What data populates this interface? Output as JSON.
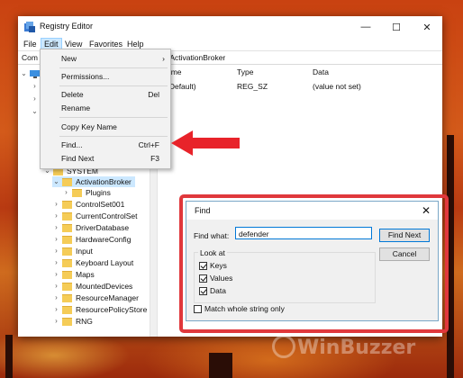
{
  "window": {
    "title": "Registry Editor",
    "controls": {
      "minimize": "—",
      "maximize": "☐",
      "close": "✕"
    }
  },
  "menubar": {
    "items": [
      "File",
      "Edit",
      "View",
      "Favorites",
      "Help"
    ],
    "active": "Edit"
  },
  "address": {
    "left": "Com",
    "right": "\\ActivationBroker"
  },
  "edit_menu": {
    "items": [
      {
        "label": "New",
        "shortcut": "",
        "submenu": true
      },
      {
        "label": "Permissions...",
        "shortcut": ""
      },
      {
        "label": "Delete",
        "shortcut": "Del"
      },
      {
        "label": "Rename",
        "shortcut": ""
      },
      {
        "label": "Copy Key Name",
        "shortcut": ""
      },
      {
        "label": "Find...",
        "shortcut": "Ctrl+F"
      },
      {
        "label": "Find Next",
        "shortcut": "F3"
      }
    ]
  },
  "columns": {
    "name": "ame",
    "type": "Type",
    "data": "Data"
  },
  "value_row": {
    "name": "(Default)",
    "type": "REG_SZ",
    "data": "(value not set)"
  },
  "tree": {
    "items": [
      {
        "label": "SYSTEM",
        "expanded": true
      },
      {
        "label": "ActivationBroker",
        "expanded": true,
        "selected": true
      },
      {
        "label": "Plugins"
      },
      {
        "label": "ControlSet001"
      },
      {
        "label": "CurrentControlSet"
      },
      {
        "label": "DriverDatabase"
      },
      {
        "label": "HardwareConfig"
      },
      {
        "label": "Input"
      },
      {
        "label": "Keyboard Layout"
      },
      {
        "label": "Maps"
      },
      {
        "label": "MountedDevices"
      },
      {
        "label": "ResourceManager"
      },
      {
        "label": "ResourcePolicyStore"
      },
      {
        "label": "RNG"
      }
    ]
  },
  "find_dialog": {
    "title": "Find",
    "find_what_label": "Find what:",
    "find_what_value": "defender",
    "find_next_button": "Find Next",
    "cancel_button": "Cancel",
    "look_at_label": "Look at",
    "checkboxes": [
      {
        "label": "Keys",
        "checked": true
      },
      {
        "label": "Values",
        "checked": true
      },
      {
        "label": "Data",
        "checked": true
      }
    ],
    "match_whole_label": "Match whole string only",
    "match_whole_checked": false
  },
  "watermark": "WinBuzzer",
  "colors": {
    "highlight_outline": "#e0383c",
    "arrow": "#e8232a",
    "selection": "#cce8ff"
  }
}
